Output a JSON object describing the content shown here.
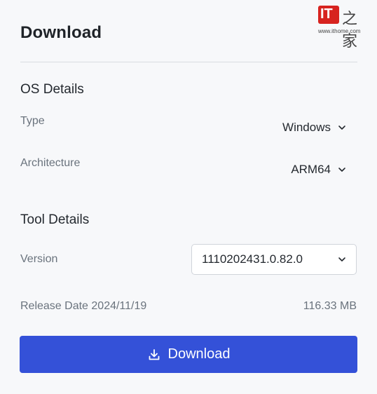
{
  "header": {
    "title": "Download"
  },
  "watermark": {
    "logo_text": "IT",
    "logo_glyph": "之家",
    "site": "www.ithome.com",
    "brand_color": "#d7231f"
  },
  "os_details": {
    "heading": "OS Details",
    "type": {
      "label": "Type",
      "value": "Windows",
      "icon": "chevron-down-icon"
    },
    "architecture": {
      "label": "Architecture",
      "value": "ARM64",
      "icon": "chevron-down-icon"
    }
  },
  "tool_details": {
    "heading": "Tool Details",
    "version": {
      "label": "Version",
      "value": "1110202431.0.82.0",
      "icon": "chevron-down-icon"
    },
    "release_date": "Release Date 2024/11/19",
    "size": "116.33 MB"
  },
  "download_button": {
    "label": "Download",
    "icon": "download-icon",
    "color": "#3451d8"
  }
}
